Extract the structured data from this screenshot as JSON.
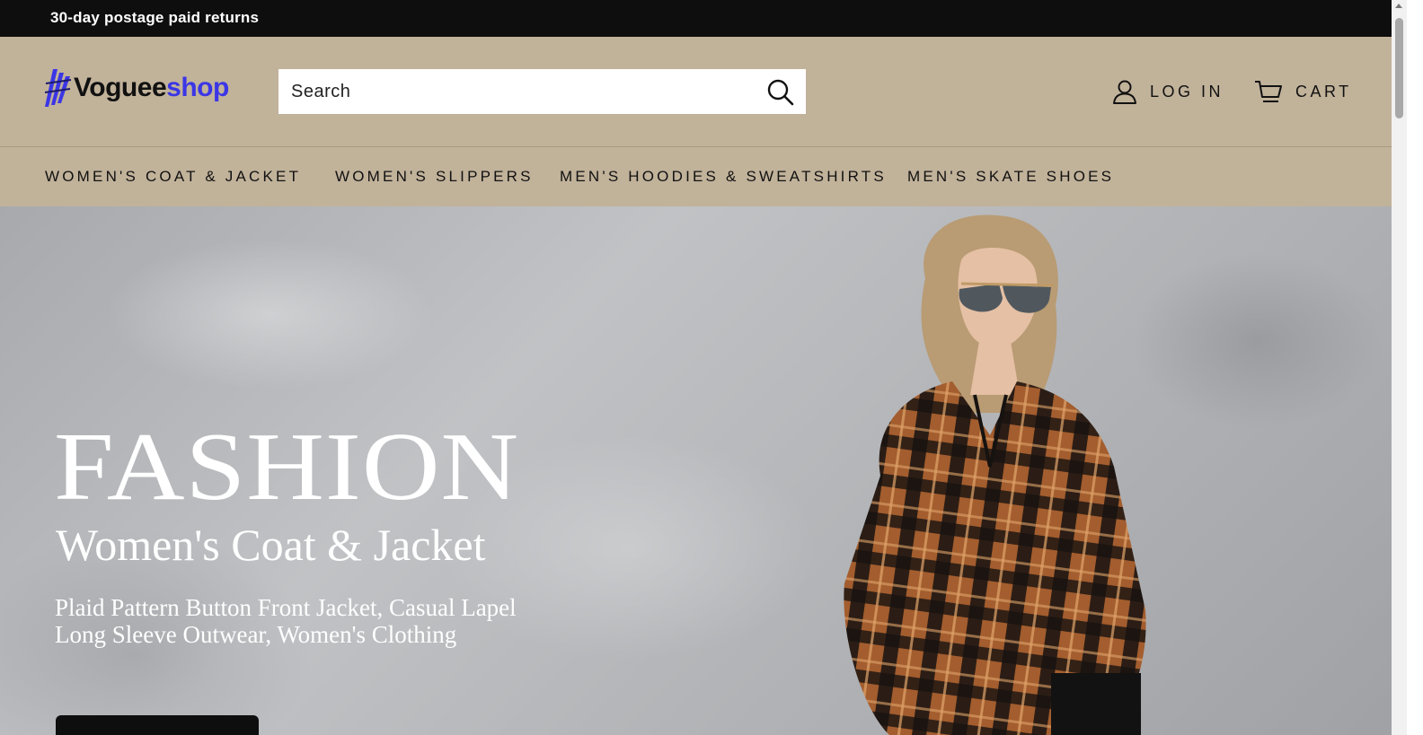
{
  "announcement": {
    "text": "30-day postage paid returns"
  },
  "header": {
    "logo_part1": "Voguee",
    "logo_part2": "shop",
    "search_placeholder": "Search",
    "login_label": "LOG IN",
    "cart_label": "CART"
  },
  "nav": {
    "items": [
      {
        "label": "WOMEN'S COAT & JACKET"
      },
      {
        "label": "WOMEN'S SLIPPERS"
      },
      {
        "label": "MEN'S HOODIES & SWEATSHIRTS"
      },
      {
        "label": "MEN'S SKATE SHOES"
      }
    ]
  },
  "hero": {
    "title": "FASHION",
    "subtitle": "Women's Coat & Jacket",
    "description_line1": "Plaid Pattern Button Front Jacket, Casual Lapel",
    "description_line2": "Long Sleeve Outwear, Women's Clothing"
  },
  "colors": {
    "header_bg": "#c1b29a",
    "announcement_bg": "#0e0e0e",
    "logo_accent": "#3b36e6"
  },
  "icons": [
    "logo-mark-icon",
    "search-icon",
    "user-icon",
    "cart-icon"
  ]
}
